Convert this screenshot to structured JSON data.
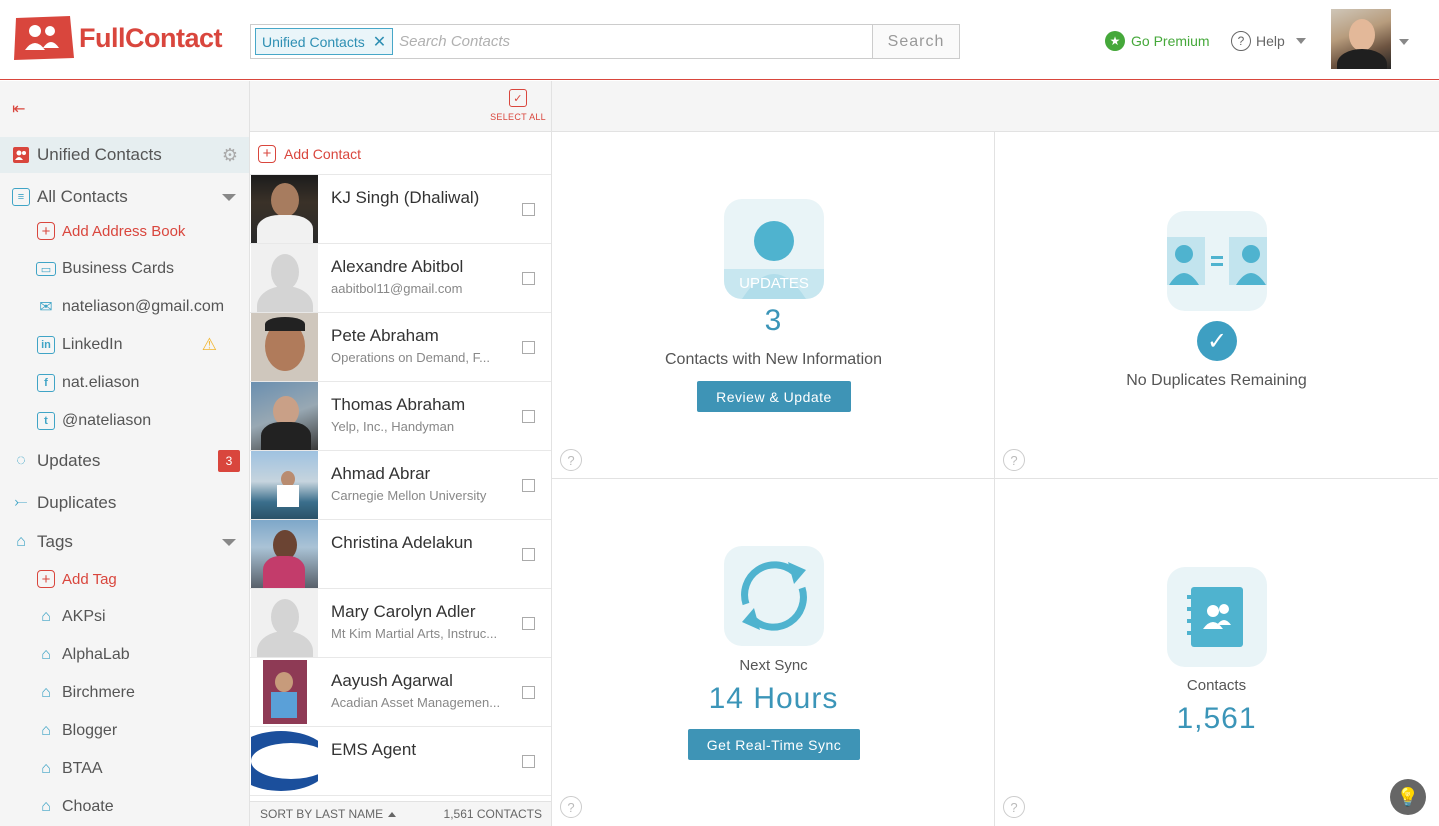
{
  "header": {
    "logo_text": "FullContact",
    "search_chip": "Unified Contacts",
    "search_placeholder": "Search Contacts",
    "search_button": "Search",
    "premium_label": "Go Premium",
    "help_label": "Help"
  },
  "sidebar": {
    "unified": "Unified Contacts",
    "all_contacts": "All Contacts",
    "add_address_book": "Add Address Book",
    "sources": [
      {
        "label": "Business Cards",
        "icon": "business-card-icon"
      },
      {
        "label": "nateliason@gmail.com",
        "icon": "mail-icon"
      },
      {
        "label": "LinkedIn",
        "icon": "linkedin-icon"
      },
      {
        "label": "nat.eliason",
        "icon": "facebook-icon"
      },
      {
        "label": "@nateliason",
        "icon": "twitter-icon"
      }
    ],
    "updates": "Updates",
    "updates_count": "3",
    "duplicates": "Duplicates",
    "tags": "Tags",
    "add_tag": "Add Tag",
    "tag_items": [
      "AKPsi",
      "AlphaLab",
      "Birchmere",
      "Blogger",
      "BTAA",
      "Choate"
    ]
  },
  "list": {
    "select_all": "SELECT ALL",
    "add_contact": "Add Contact",
    "contacts": [
      {
        "name": "KJ Singh (Dhaliwal)",
        "sub": ""
      },
      {
        "name": "Alexandre Abitbol",
        "sub": "aabitbol11@gmail.com"
      },
      {
        "name": "Pete Abraham",
        "sub": "Operations on Demand, F..."
      },
      {
        "name": "Thomas Abraham",
        "sub": "Yelp, Inc., Handyman"
      },
      {
        "name": "Ahmad Abrar",
        "sub": "Carnegie Mellon University"
      },
      {
        "name": "Christina Adelakun",
        "sub": ""
      },
      {
        "name": "Mary Carolyn Adler",
        "sub": "Mt Kim Martial Arts, Instruc..."
      },
      {
        "name": "Aayush Agarwal",
        "sub": "Acadian Asset Managemen..."
      },
      {
        "name": "EMS Agent",
        "sub": ""
      }
    ],
    "sort_label": "SORT BY LAST NAME",
    "count_label": "1,561 CONTACTS"
  },
  "dashboard": {
    "updates_badge": "UPDATES",
    "updates_num": "3",
    "updates_text": "Contacts with New Information",
    "updates_button": "Review & Update",
    "dup_text": "No Duplicates Remaining",
    "sync_label": "Next Sync",
    "sync_value": "14 Hours",
    "sync_button": "Get Real-Time Sync",
    "contacts_label": "Contacts",
    "contacts_value": "1,561",
    "help_glyph": "?"
  },
  "colors": {
    "brand_red": "#d9463d",
    "accent_blue": "#3e94b6",
    "premium_green": "#45a83a"
  }
}
